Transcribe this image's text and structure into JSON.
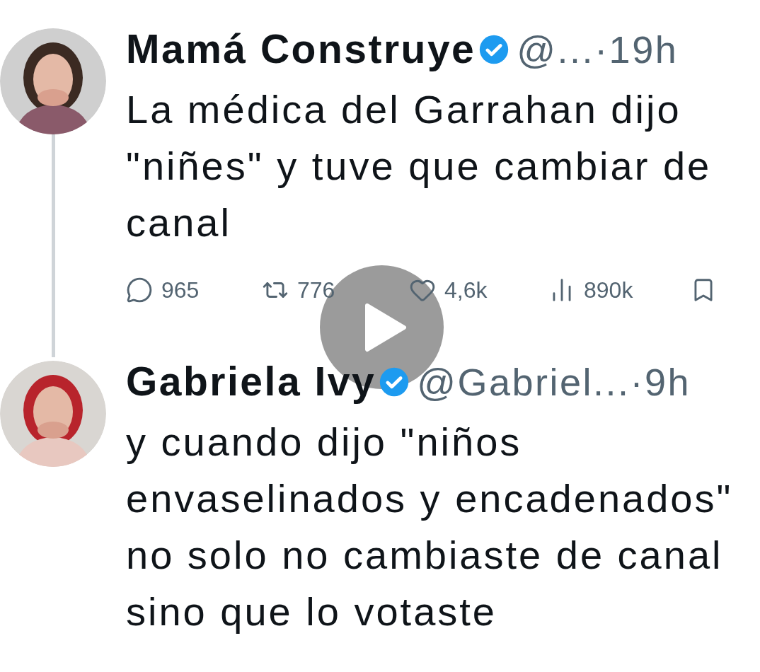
{
  "tweets": [
    {
      "name": "Mamá Construye",
      "verified": true,
      "handle": "@...",
      "time": "·19h",
      "thread_line": true,
      "lines": [
        "La médica del Garrahan dijo",
        "\"niñes\" y tuve que cambiar de",
        "canal"
      ],
      "actions": [
        {
          "kind": "reply",
          "count": "965"
        },
        {
          "kind": "retweet",
          "count": "776"
        },
        {
          "kind": "like",
          "count": "4,6k"
        },
        {
          "kind": "views",
          "count": "890k"
        },
        {
          "kind": "bookmark"
        }
      ]
    },
    {
      "name": "Gabriela Ivy",
      "verified": true,
      "handle": "@Gabriel...",
      "time": "·9h",
      "thread_line": false,
      "lines": [
        "y cuando dijo \"niños",
        "envaselinados y encadenados\"",
        "no solo no cambiaste de canal",
        "sino que lo votaste"
      ]
    }
  ],
  "overlay": {
    "kind": "play"
  }
}
